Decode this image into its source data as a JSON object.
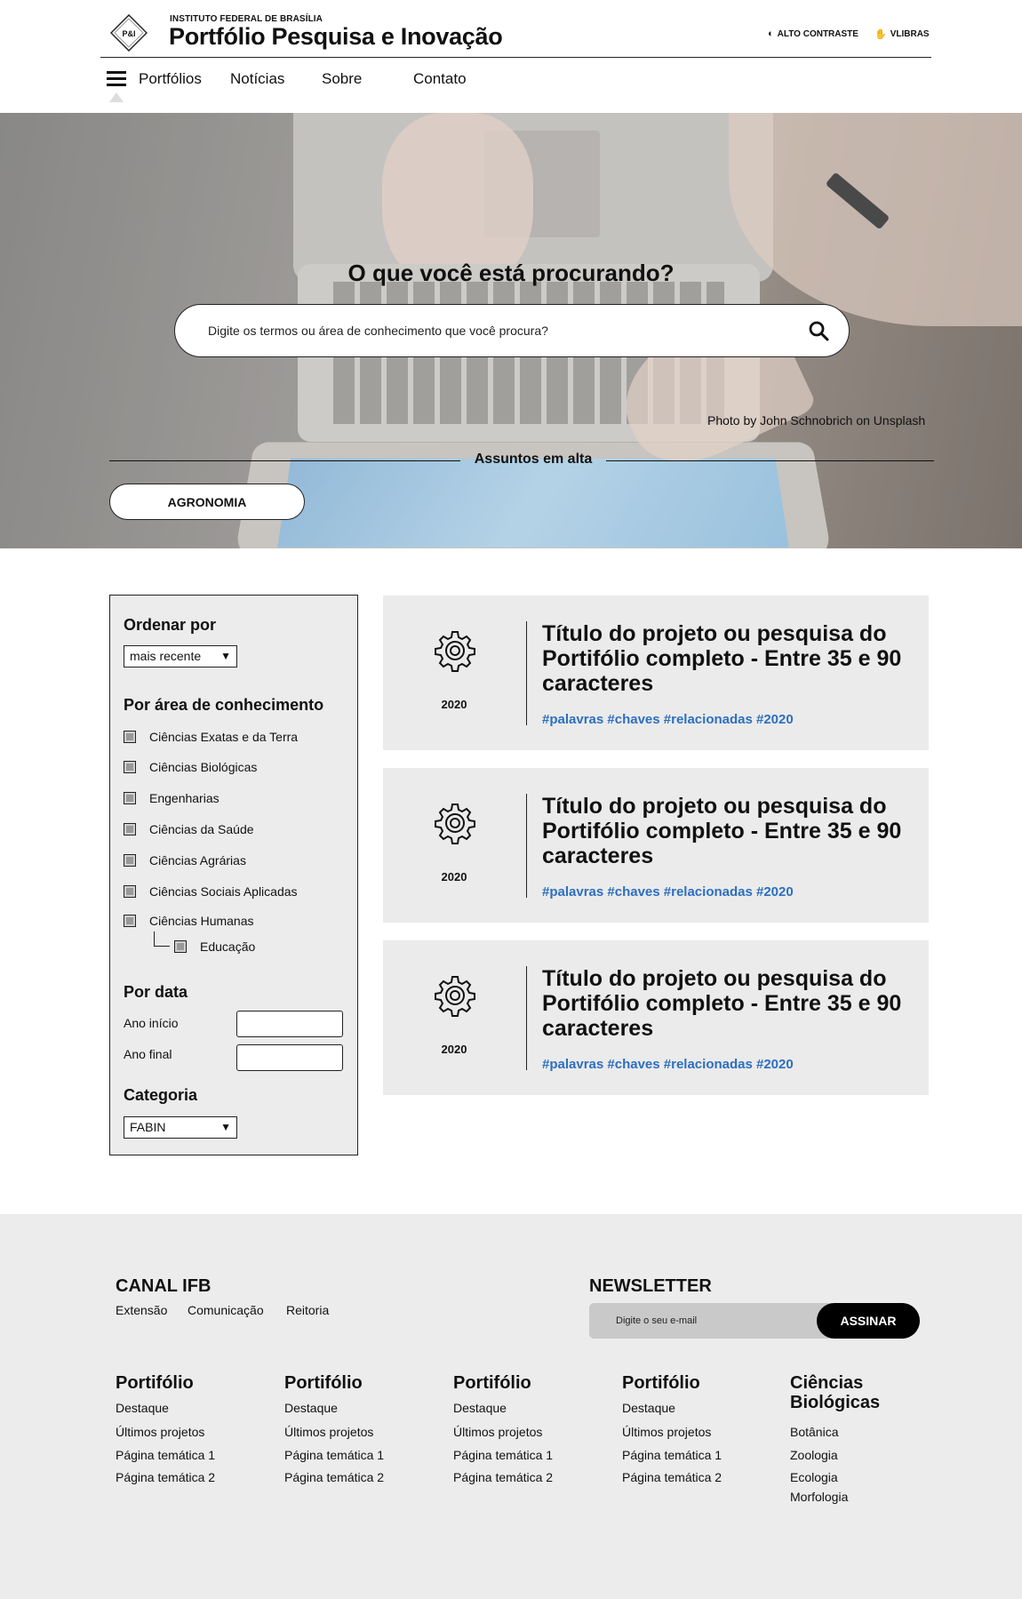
{
  "header": {
    "institute": "INSTITUTO FEDERAL DE BRASÍLIA",
    "title": "Portfólio Pesquisa e Inovação",
    "logo_text": "P&I",
    "accessibility": {
      "contrast": "ALTO CONTRASTE",
      "vlibras": "VLIBRAS"
    },
    "nav": [
      "Portfólios",
      "Notícias",
      "Sobre",
      "Contato"
    ]
  },
  "hero": {
    "heading": "O que você está procurando?",
    "search_placeholder": "Digite os termos ou área de conhecimento que você procura?",
    "photo_credit": "Photo by John Schnobrich on Unsplash",
    "trending_label": "Assuntos em alta",
    "trending": [
      "AGRONOMIA"
    ]
  },
  "filters": {
    "sort_heading": "Ordenar por",
    "sort_value": "mais recente",
    "area_heading": "Por área de conhecimento",
    "areas": [
      "Ciências Exatas e da Terra",
      "Ciências Biológicas",
      "Engenharias",
      "Ciências da Saúde",
      "Ciências Agrárias",
      "Ciências Sociais Aplicadas",
      "Ciências Humanas"
    ],
    "sub_area": "Educação",
    "date_heading": "Por data",
    "start_label": "Ano início",
    "end_label": "Ano final",
    "category_heading": "Categoria",
    "category_value": "FABIN"
  },
  "results": [
    {
      "year": "2020",
      "title": "Título do projeto ou pesquisa do Portifólio completo - Entre 35 e 90 caracteres",
      "tags": "#palavras #chaves #relacionadas #2020"
    },
    {
      "year": "2020",
      "title": "Título do projeto ou pesquisa do Portifólio completo - Entre 35 e 90 caracteres",
      "tags": "#palavras #chaves #relacionadas #2020"
    },
    {
      "year": "2020",
      "title": "Título do projeto ou pesquisa do Portifólio completo - Entre 35 e 90 caracteres",
      "tags": "#palavras #chaves #relacionadas #2020"
    }
  ],
  "footer": {
    "canal_heading": "CANAL IFB",
    "canal_links": [
      "Extensão",
      "Comunicação",
      "Reitoria"
    ],
    "newsletter_heading": "NEWSLETTER",
    "newsletter_placeholder": "Digite o seu e-mail",
    "newsletter_button": "ASSINAR",
    "columns": [
      {
        "heading": "Portifólio",
        "links": [
          "Destaque",
          "Últimos projetos",
          "Página temática 1",
          "Página temática 2"
        ]
      },
      {
        "heading": "Portifólio",
        "links": [
          "Destaque",
          "Últimos projetos",
          "Página temática 1",
          "Página temática 2"
        ]
      },
      {
        "heading": "Portifólio",
        "links": [
          "Destaque",
          "Últimos projetos",
          "Página temática 1",
          "Página temática 2"
        ]
      },
      {
        "heading": "Portifólio",
        "links": [
          "Destaque",
          "Últimos projetos",
          "Página temática 1",
          "Página temática 2"
        ]
      },
      {
        "heading": "Ciências Biológicas",
        "links": [
          "Botânica",
          "Zoologia",
          "Ecologia",
          "Morfologia"
        ]
      }
    ]
  },
  "colors": {
    "tag_blue": "#2d6fbf",
    "panel_gray": "#ececec",
    "card_gray": "#ebebeb"
  }
}
